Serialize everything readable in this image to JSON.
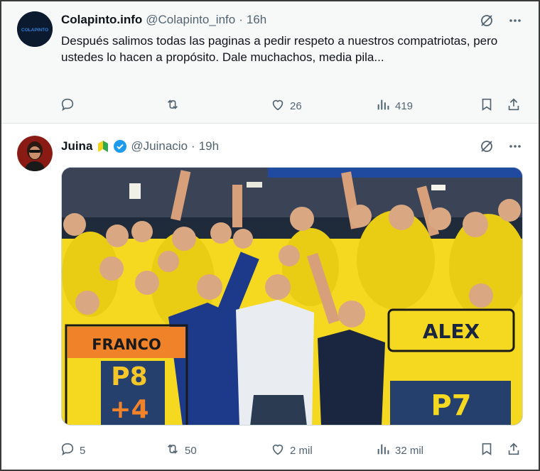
{
  "tweets": [
    {
      "author": "Colapinto.info",
      "handle": "@Colapinto_info",
      "time": "16h",
      "avatar_text": "COLAPINTO",
      "text": "Después salimos todas las paginas a pedir respeto a nuestros compatriotas, pero ustedes lo hacen a propósito. Dale muchachos, media pila...",
      "replies": "",
      "retweets": "",
      "likes": "26",
      "views": "419"
    },
    {
      "author": "Juina",
      "handle": "@Juinacio",
      "time": "19h",
      "verified": true,
      "replies": "5",
      "retweets": "50",
      "likes": "2 mil",
      "views": "32 mil",
      "photo": {
        "signs": {
          "franco_name": "FRANCO",
          "franco_pos": "P8",
          "franco_gain": "+4",
          "alex_name": "ALEX",
          "alex_pos": "P7"
        },
        "colors": {
          "team_yellow": "#f5d921",
          "franco_sign": "#f0822a",
          "driver_suit": "#1d3a8a"
        }
      }
    }
  ],
  "colors": {
    "icon_gray": "#536471",
    "verified_blue": "#1d9bf0",
    "accent": "#1d9bf0"
  },
  "icons": [
    "reply-icon",
    "retweet-icon",
    "like-icon",
    "views-icon",
    "bookmark-icon",
    "share-icon",
    "grok-icon",
    "more-icon"
  ]
}
